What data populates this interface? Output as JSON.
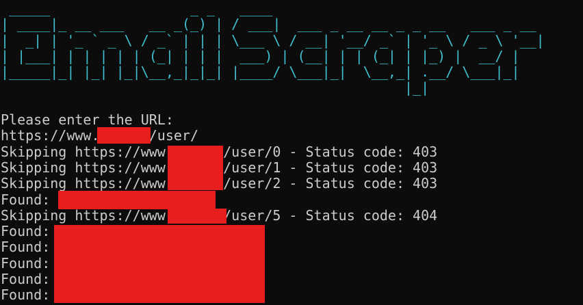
{
  "colors": {
    "background": "#0c0c0c",
    "text": "#cccccc",
    "banner": "#3fbfcf",
    "redaction": "#e81e1e"
  },
  "banner": [
    " _____                 _ _   ____",
    "| ____|_ __ ___   __ _(_) | / ___|  ___ _ __ __ _ _ __   ___ _ __",
    "|  _| | '_ ` _ \\ / _` | | | \\___ \\ / __| '__/ _` | '_ \\ / _ \\ '__|",
    "| |___| | | | | | (_| | | |  ___) | (__| | | (_| | |_) |  __/ |",
    "|_____|_| |_| |_|\\__,_|_|_| |____/ \\___|_|  \\__,_| .__/ \\___|_|",
    "                                                 |_|"
  ],
  "output": [
    "",
    "Please enter the URL:",
    "https://www.      /user/",
    "Skipping https://www       /user/0 - Status code: 403",
    "Skipping https://www       /user/1 - Status code: 403",
    "Skipping https://www       /user/2 - Status code: 403",
    "Found: ",
    "Skipping https://www       /user/5 - Status code: 404",
    "Found: ",
    "Found: ",
    "Found: ",
    "Found: ",
    "Found: "
  ]
}
